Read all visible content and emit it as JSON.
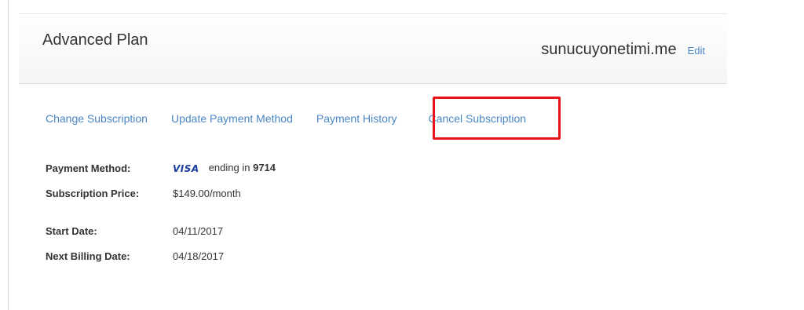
{
  "plan": {
    "title": "Advanced Plan",
    "domain": "sunucuyonetimi.me",
    "edit_label": "Edit"
  },
  "nav": {
    "change_subscription": "Change Subscription",
    "update_payment_method": "Update Payment Method",
    "payment_history": "Payment History",
    "cancel_subscription": "Cancel Subscription"
  },
  "details": {
    "payment_method_label": "Payment Method:",
    "card_brand": "VISA",
    "ending_in_text": "ending in",
    "card_last4": "9714",
    "price_label": "Subscription Price:",
    "price_value": "$149.00/month",
    "start_date_label": "Start Date:",
    "start_date_value": "04/11/2017",
    "next_billing_label": "Next Billing Date:",
    "next_billing_value": "04/18/2017"
  },
  "colors": {
    "link": "#4a86c5",
    "highlight": "#e8131b",
    "visa": "#1a3d9c"
  }
}
